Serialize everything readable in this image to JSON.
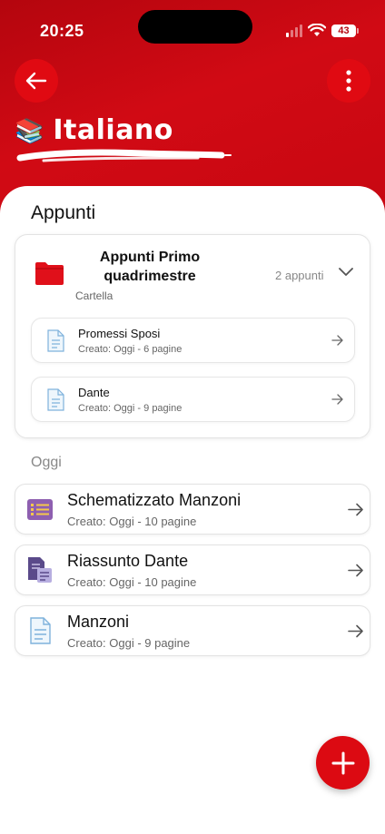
{
  "status": {
    "time": "20:25",
    "battery": "43"
  },
  "header": {
    "emoji": "📚",
    "title": "Italiano"
  },
  "notes_section": {
    "title": "Appunti"
  },
  "folder": {
    "name": "Appunti Primo quadrimestre",
    "type": "Cartella",
    "count": "2 appunti",
    "items": [
      {
        "name": "Promessi Sposi",
        "meta": "Creato: Oggi - 6 pagine"
      },
      {
        "name": "Dante",
        "meta": "Creato: Oggi - 9 pagine"
      }
    ]
  },
  "today": {
    "label": "Oggi",
    "items": [
      {
        "name": "Schematizzato Manzoni",
        "meta": "Creato: Oggi - 10 pagine",
        "icon": "list-icon"
      },
      {
        "name": "Riassunto Dante",
        "meta": "Creato: Oggi - 10 pagine",
        "icon": "summary-icon"
      },
      {
        "name": "Manzoni",
        "meta": "Creato: Oggi - 9 pagine",
        "icon": "document-icon"
      }
    ]
  },
  "colors": {
    "brand": "#d10a14",
    "folder": "#e0101a",
    "list_icon": "#8e5fb0",
    "summary_icon": "#5a4a8a",
    "doc_icon": "#6fa8d6"
  }
}
